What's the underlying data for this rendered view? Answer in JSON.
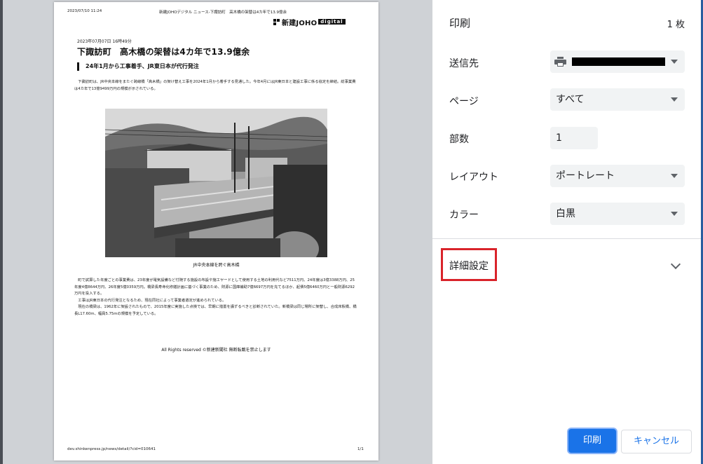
{
  "preview": {
    "header_date": "2023/07/10 11:24",
    "header_title": "新建JOHOデジタル ニュース-下諏訪町　高木橋の架替は4カ年で13.9億余",
    "logo_text": "新建JOHO",
    "logo_digital": "digital",
    "article_date": "2023年07月07日 16時49分",
    "article_title": "下諏訪町　高木橋の架替は4カ年で13.9億余",
    "article_subtitle": "24年1月から工事着手、JR東日本が代行発注",
    "paragraph1": "　下諏訪町は、JR中央本線をまたぐ跨線橋「高木橋」の架け替え工事を2024年1月から着手する見通した。今年4月にはJR東日本と建設工事に係る協定を締結。総事業費は4カ年で13億9499万円の規模が示されている。",
    "photo_caption": "JR中央本線を跨ぐ高木橋",
    "paragraph2": "　町で試算した年度ごとの事業費は、23年度が電気設備など付随する施設の布設や施工ヤードとして使用する土地の利用代など7511万円、24年度は3億3388万円、25年度4億8644万円、26年度5億0359万円。橋梁長寿命化修繕計画に基づく事業のため、財源に国庫補助7億6697万円を充てるほか、起債5億6460万円と一般財源6292万円を投入する。\n　工事はJR東日本の代行発注となるため、現在同社によって事業者選定が進められている。\n　現在の橋梁は、1962年に架設されたもので、2015年度に実施した点検では、早期に措置を講ずるべきと診断されていた。新橋梁は同じ場所に架替し、合成床板橋、橋長L17.60m、幅員5.75mの規模を予定している。",
    "rights": "All Rights reserved ©新建新聞社 無断転載を禁止します",
    "footer_url": "dev.shinkenpress.jp/news/detail/?cid=010641",
    "footer_page": "1/1"
  },
  "panel": {
    "title": "印刷",
    "sheet_count": "1 枚",
    "destination_label": "送信先",
    "destination_value": "",
    "pages_label": "ページ",
    "pages_value": "すべて",
    "copies_label": "部数",
    "copies_value": "1",
    "layout_label": "レイアウト",
    "layout_value": "ポートレート",
    "color_label": "カラー",
    "color_value": "白黒",
    "advanced_label": "詳細設定",
    "print_button": "印刷",
    "cancel_button": "キャンセル"
  },
  "colors": {
    "accent": "#1a73e8",
    "highlight_box": "#d9232a",
    "field_bg": "#f1f3f4"
  },
  "icons": {
    "destination": "printer-icon",
    "advanced": "chevron-down-icon",
    "selects": "caret-down-icon"
  }
}
